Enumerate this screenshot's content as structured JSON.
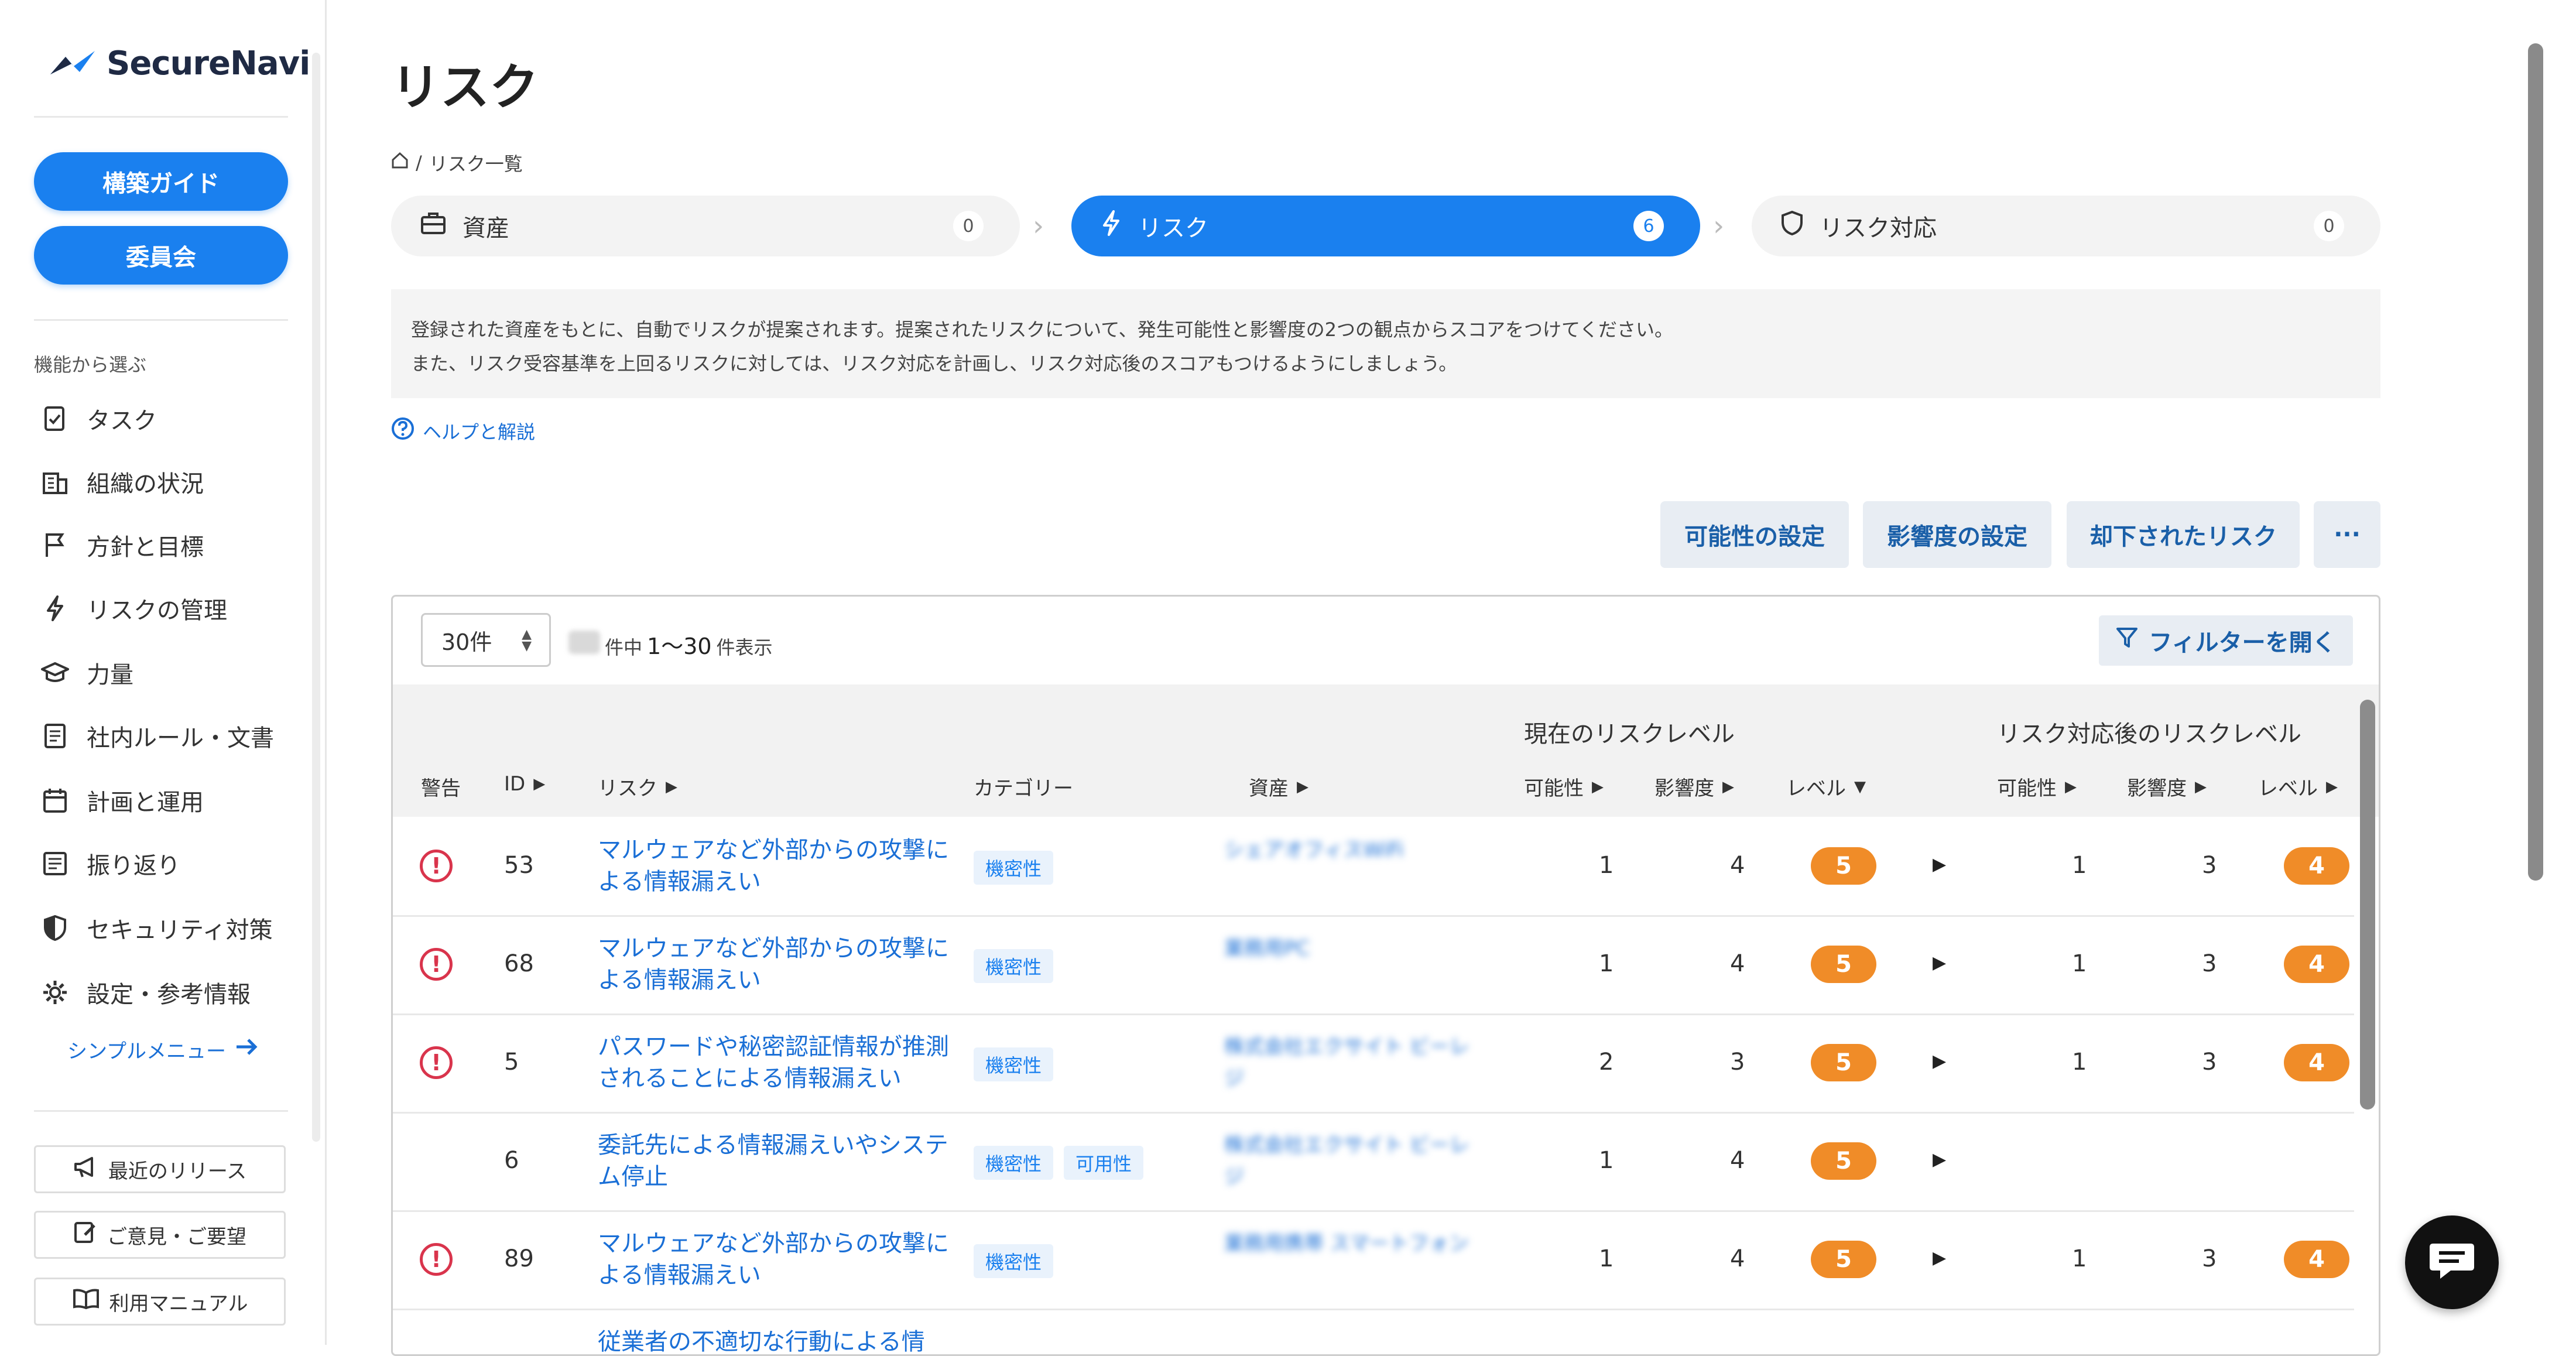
{
  "app": {
    "logo_text": "SecureNavi"
  },
  "sidebar": {
    "primary_buttons": [
      "構築ガイド",
      "委員会"
    ],
    "section_label": "機能から選ぶ",
    "items": [
      {
        "label": "タスク",
        "icon": "task-check-icon"
      },
      {
        "label": "組織の状況",
        "icon": "building-icon"
      },
      {
        "label": "方針と目標",
        "icon": "flag-icon"
      },
      {
        "label": "リスクの管理",
        "icon": "bolt-icon"
      },
      {
        "label": "力量",
        "icon": "graduation-cap-icon"
      },
      {
        "label": "社内ルール・文書",
        "icon": "document-icon"
      },
      {
        "label": "計画と運用",
        "icon": "calendar-icon"
      },
      {
        "label": "振り返り",
        "icon": "review-icon"
      },
      {
        "label": "セキュリティ対策",
        "icon": "shield-icon"
      },
      {
        "label": "設定・参考情報",
        "icon": "gear-icon"
      }
    ],
    "simple_menu": "シンプルメニュー",
    "bottom_buttons": [
      {
        "label": "最近のリリース",
        "icon": "megaphone-icon"
      },
      {
        "label": "ご意見・ご要望",
        "icon": "feedback-icon"
      },
      {
        "label": "利用マニュアル",
        "icon": "book-icon"
      }
    ]
  },
  "page": {
    "title": "リスク",
    "breadcrumb": "リスク一覧",
    "steps": [
      {
        "label": "資産",
        "count": "0",
        "icon": "briefcase-icon"
      },
      {
        "label": "リスク",
        "count": "6",
        "icon": "bolt-icon"
      },
      {
        "label": "リスク対応",
        "count": "0",
        "icon": "shield-outline-icon"
      }
    ],
    "info_lines": [
      "登録された資産をもとに、自動でリスクが提案されます。提案されたリスクについて、発生可能性と影響度の2つの観点からスコアをつけてください。",
      "また、リスク受容基準を上回るリスクに対しては、リスク対応を計画し、リスク対応後のスコアもつけるようにしましょう。"
    ],
    "help_link": "ヘルプと解説",
    "actions": [
      "可能性の設定",
      "影響度の設定",
      "却下されたリスク",
      "···"
    ]
  },
  "table": {
    "per_page": "30件",
    "total_suffix": "件中",
    "range": "1〜30",
    "range_suffix": "件表示",
    "filter_button": "フィルターを開く",
    "group_current": "現在のリスクレベル",
    "group_after": "リスク対応後のリスクレベル",
    "headers": {
      "warning": "警告",
      "id": "ID",
      "risk": "リスク",
      "category": "カテゴリー",
      "asset": "資産",
      "likelihood": "可能性",
      "impact": "影響度",
      "level": "レベル"
    },
    "rows": [
      {
        "warn": true,
        "id": "53",
        "risk": "マルウェアなど外部からの攻撃による情報漏えい",
        "tags": [
          "機密性"
        ],
        "asset": "シェアオフィスWiFi",
        "cur_l": "1",
        "cur_i": "4",
        "cur_lv": "5",
        "aft_l": "1",
        "aft_i": "3",
        "aft_lv": "4"
      },
      {
        "warn": true,
        "id": "68",
        "risk": "マルウェアなど外部からの攻撃による情報漏えい",
        "tags": [
          "機密性"
        ],
        "asset": "業務用PC",
        "cur_l": "1",
        "cur_i": "4",
        "cur_lv": "5",
        "aft_l": "1",
        "aft_i": "3",
        "aft_lv": "4"
      },
      {
        "warn": true,
        "id": "5",
        "risk": "パスワードや秘密認証情報が推測されることによる情報漏えい",
        "tags": [
          "機密性"
        ],
        "asset": "株式会社エクサイト ビーレジ",
        "cur_l": "2",
        "cur_i": "3",
        "cur_lv": "5",
        "aft_l": "1",
        "aft_i": "3",
        "aft_lv": "4"
      },
      {
        "warn": false,
        "id": "6",
        "risk": "委託先による情報漏えいやシステム停止",
        "tags": [
          "機密性",
          "可用性"
        ],
        "asset": "株式会社エクサイト ビーレジ",
        "cur_l": "1",
        "cur_i": "4",
        "cur_lv": "5",
        "aft_l": "",
        "aft_i": "",
        "aft_lv": ""
      },
      {
        "warn": true,
        "id": "89",
        "risk": "マルウェアなど外部からの攻撃による情報漏えい",
        "tags": [
          "機密性"
        ],
        "asset": "業務用携帯 スマートフォン",
        "cur_l": "1",
        "cur_i": "4",
        "cur_lv": "5",
        "aft_l": "1",
        "aft_i": "3",
        "aft_lv": "4"
      },
      {
        "warn": false,
        "id": "",
        "risk": "従業者の不適切な行動による情",
        "tags": [],
        "asset": "",
        "cur_l": "",
        "cur_i": "",
        "cur_lv": "",
        "aft_l": "",
        "aft_i": "",
        "aft_lv": ""
      }
    ]
  },
  "colors": {
    "accent": "#1a80ef",
    "level_badge": "#f08c28",
    "warning": "#d9344c"
  }
}
